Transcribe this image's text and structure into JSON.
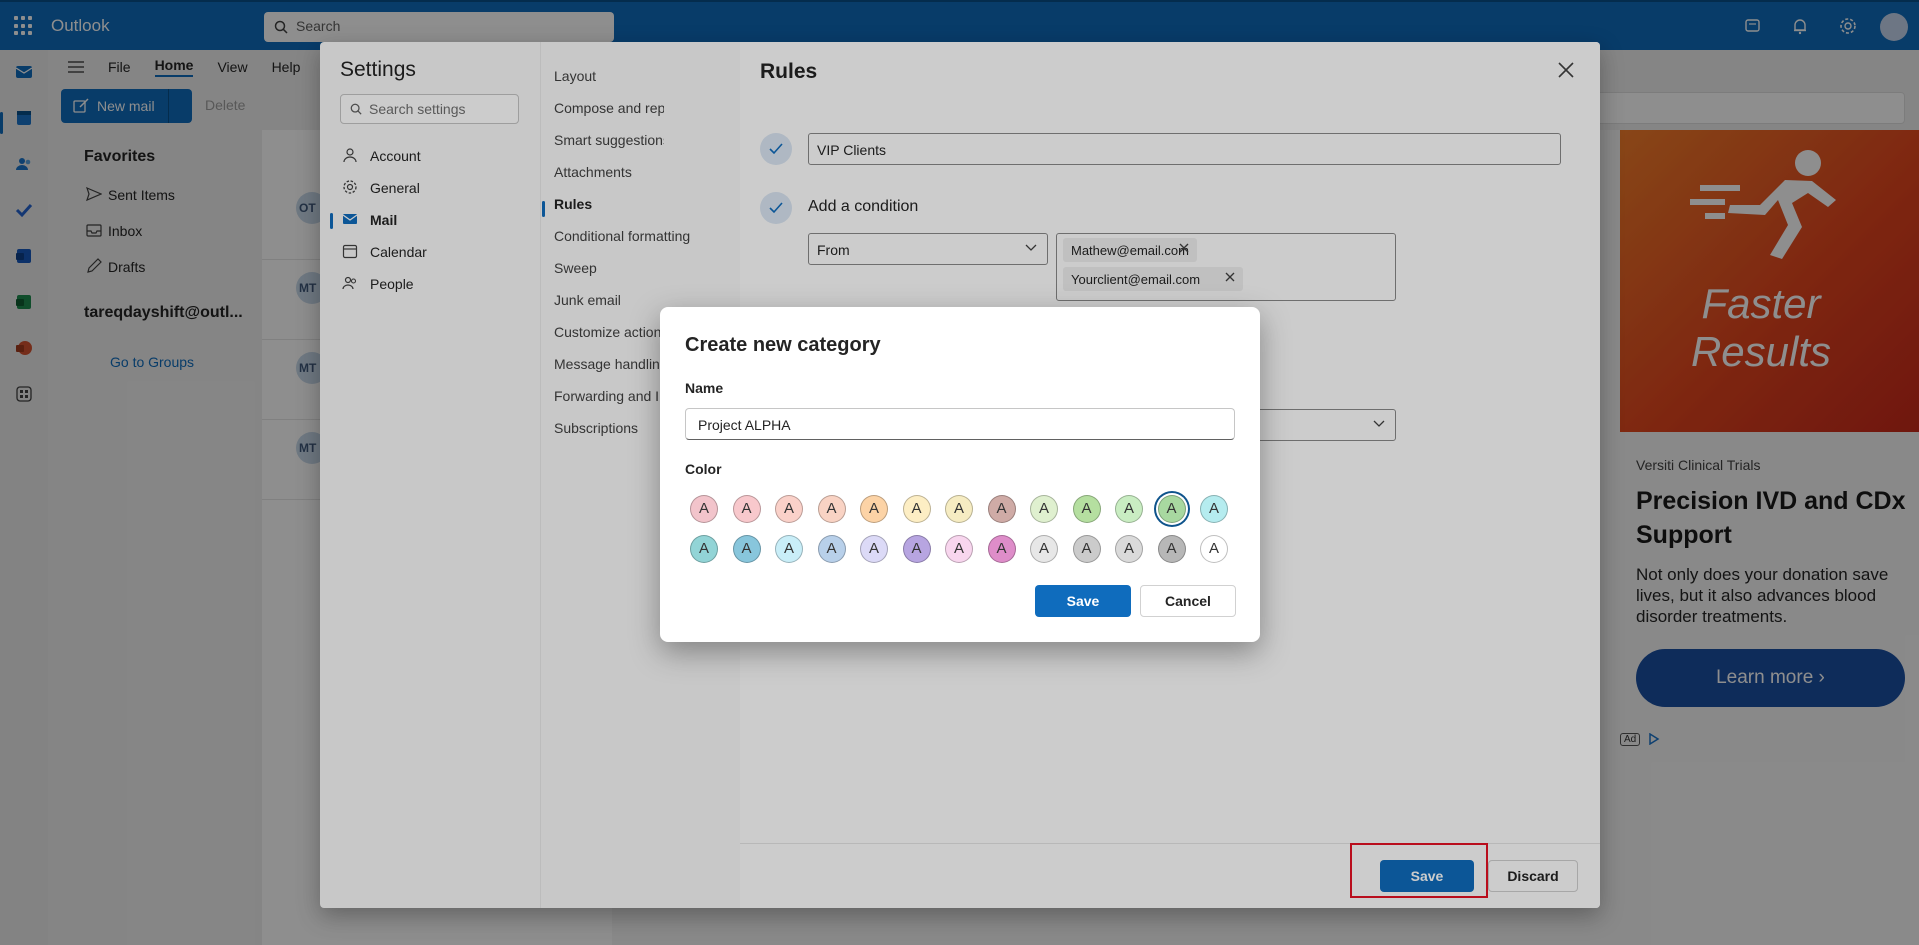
{
  "topbar": {
    "app_name": "Outlook",
    "search_placeholder": "Search"
  },
  "ribbon": {
    "menu": [
      "File",
      "Home",
      "View",
      "Help"
    ],
    "active_menu": "Home",
    "new_mail": "New mail",
    "delete": "Delete"
  },
  "folders": {
    "favorites": "Favorites",
    "items": [
      "Sent Items",
      "Inbox",
      "Drafts"
    ],
    "account": "tareqdayshift@outl...",
    "go_to_groups": "Go to Groups"
  },
  "message_list": {
    "avatars": [
      "OT",
      "MT",
      "MT",
      "MT"
    ]
  },
  "ad": {
    "image_text_1": "Faster",
    "image_text_2": "Results",
    "sponsor": "Versiti Clinical Trials",
    "headline": "Precision IVD and CDx Support",
    "body": "Not only does your donation save lives, but it also advances blood disorder treatments.",
    "cta": "Learn more",
    "badge": "Ad"
  },
  "settings": {
    "title": "Settings",
    "search_placeholder": "Search settings",
    "categories": [
      "Account",
      "General",
      "Mail",
      "Calendar",
      "People"
    ],
    "active_category": "Mail",
    "subsections": [
      "Layout",
      "Compose and reply",
      "Smart suggestions",
      "Attachments",
      "Rules",
      "Conditional formatting",
      "Sweep",
      "Junk email",
      "Customize actions",
      "Message handling",
      "Forwarding and IMAP",
      "Subscriptions"
    ],
    "active_subsection": "Rules"
  },
  "rules": {
    "title": "Rules",
    "rule_name": "VIP Clients",
    "add_condition": "Add a condition",
    "condition_type": "From",
    "recipients": [
      "Mathew@email.com",
      "Yourclient@email.com"
    ],
    "save": "Save",
    "discard": "Discard"
  },
  "category_modal": {
    "title": "Create new category",
    "name_label": "Name",
    "name_value": "Project ALPHA",
    "color_label": "Color",
    "swatch_letter": "A",
    "swatch_colors": [
      "#f2c4cb",
      "#f8c8cc",
      "#fad1c9",
      "#f9d3c4",
      "#fcd3a6",
      "#fdeec4",
      "#f6ecc2",
      "#cfaba6",
      "#dff0cf",
      "#b5dfa0",
      "#c9edc2",
      "#a8d8a0",
      "#b5ecef",
      "#92d4d6",
      "#88c6dc",
      "#c9eef8",
      "#b8d0ea",
      "#dcdaf7",
      "#b7a5e1",
      "#f8d6ee",
      "#de8dc9",
      "#e7e7e7",
      "#cbcbcb",
      "#dadada",
      "#b7b7b7",
      "#ffffff"
    ],
    "selected_index": 11,
    "save": "Save",
    "cancel": "Cancel"
  }
}
